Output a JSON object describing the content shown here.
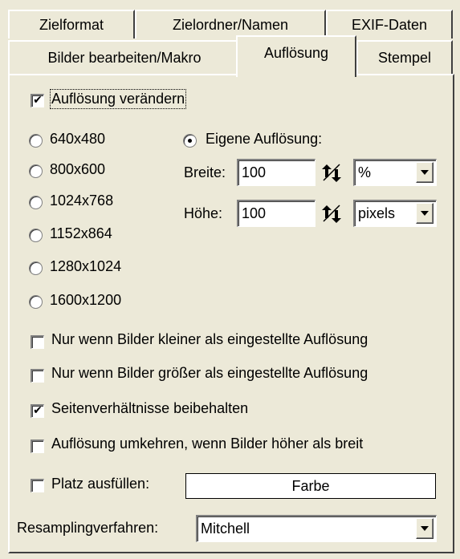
{
  "tabs_row1": [
    "Zielformat",
    "Zielordner/Namen",
    "EXIF-Daten"
  ],
  "tabs_row2": [
    "Bilder bearbeiten/Makro",
    "Auflösung",
    "Stempel"
  ],
  "active_tab": "Auflösung",
  "change_resolution": {
    "label": "Auflösung verändern",
    "checked": true
  },
  "presets": [
    {
      "label": "640x480",
      "selected": false
    },
    {
      "label": "800x600",
      "selected": false
    },
    {
      "label": "1024x768",
      "selected": false
    },
    {
      "label": "1152x864",
      "selected": false
    },
    {
      "label": "1280x1024",
      "selected": false
    },
    {
      "label": "1600x1200",
      "selected": false
    }
  ],
  "custom": {
    "label": "Eigene Auflösung:",
    "selected": true,
    "width_label": "Breite:",
    "width_value": "100",
    "width_unit": "%",
    "height_label": "Höhe:",
    "height_value": "100",
    "height_unit": "pixels"
  },
  "options": [
    {
      "label": "Nur wenn Bilder kleiner als eingestellte Auflösung",
      "checked": false
    },
    {
      "label": "Nur wenn Bilder größer als eingestellte Auflösung",
      "checked": false
    },
    {
      "label": "Seitenverhältnisse beibehalten",
      "checked": true
    },
    {
      "label": "Auflösung umkehren, wenn Bilder höher als breit",
      "checked": false
    }
  ],
  "fill": {
    "label": "Platz ausfüllen:",
    "checked": false,
    "color_button": "Farbe"
  },
  "resampling": {
    "label": "Resamplingverfahren:",
    "value": "Mitchell"
  }
}
